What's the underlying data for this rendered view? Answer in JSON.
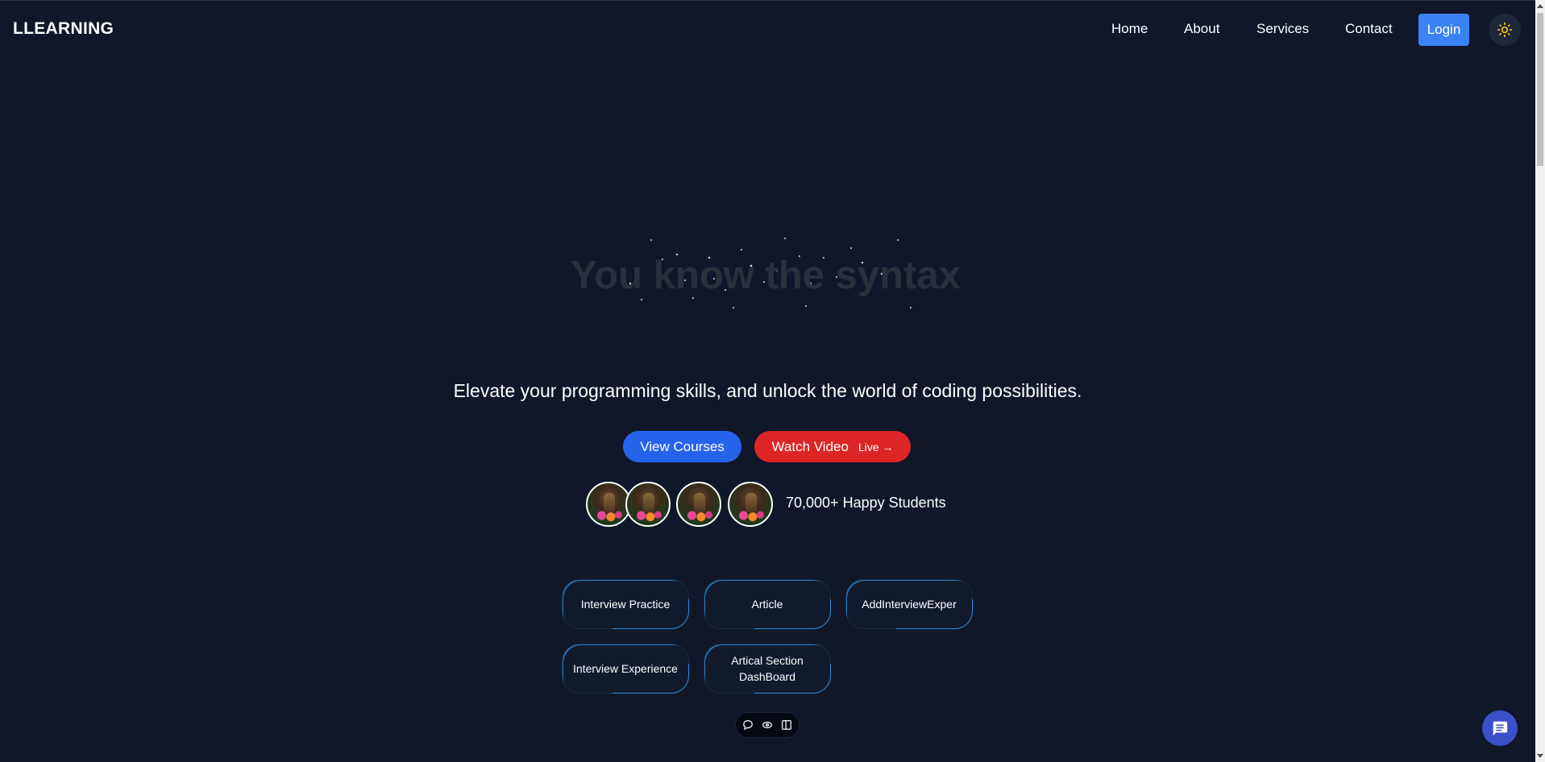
{
  "brand": {
    "name": "LLEARNING"
  },
  "nav": {
    "links": [
      "Home",
      "About",
      "Services",
      "Contact"
    ],
    "login_label": "Login",
    "theme_icon": "sun-icon"
  },
  "hero": {
    "title": "You know the syntax",
    "subtitle": "Elevate your programming skills, and unlock the world of coding possibilities.",
    "primary_button": "View Courses",
    "secondary_button": "Watch Video",
    "secondary_badge": "Live →",
    "students_text": "70,000+ Happy Students"
  },
  "cards": [
    {
      "label": "Interview Practice"
    },
    {
      "label": "Article"
    },
    {
      "label": "AddInterviewExper"
    },
    {
      "label": "Interview Experience"
    },
    {
      "label": "Artical Section DashBoard"
    }
  ],
  "toolbar_icons": [
    "comment-icon",
    "link-icon",
    "sidebar-icon"
  ],
  "chat_icon": "chat-icon",
  "colors": {
    "background": "#0f1729",
    "login": "#3b82f6",
    "courses": "#2563eb",
    "video": "#dc2626",
    "chat_fab": "#3b50c8",
    "card_accent": "#2a8be0"
  }
}
